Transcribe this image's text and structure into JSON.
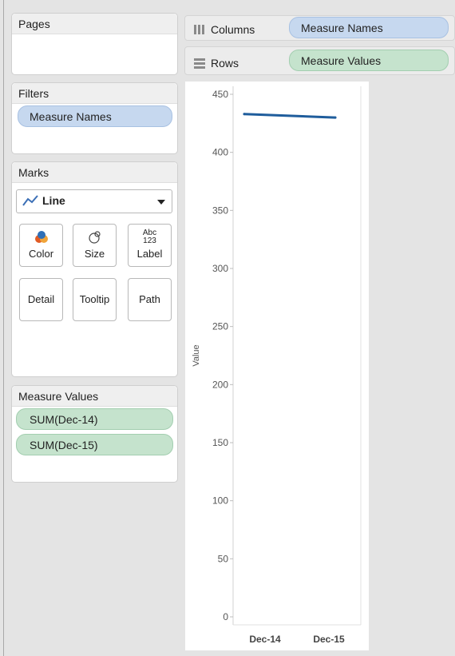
{
  "pages": {
    "title": "Pages"
  },
  "shelves": {
    "columns": {
      "label": "Columns",
      "pill": "Measure Names"
    },
    "rows": {
      "label": "Rows",
      "pill": "Measure Values"
    }
  },
  "filters": {
    "title": "Filters",
    "items": [
      "Measure Names"
    ]
  },
  "marks": {
    "title": "Marks",
    "mark_type": "Line",
    "buttons": {
      "color": "Color",
      "size": "Size",
      "label": "Label",
      "label_icon": "Abc 123",
      "detail": "Detail",
      "tooltip": "Tooltip",
      "path": "Path"
    }
  },
  "measure_values": {
    "title": "Measure Values",
    "items": [
      "SUM(Dec-14)",
      "SUM(Dec-15)"
    ]
  },
  "chart_data": {
    "type": "line",
    "categories": [
      "Dec-14",
      "Dec-15"
    ],
    "values": [
      433,
      430
    ],
    "ylabel": "Value",
    "ylim": [
      0,
      450
    ],
    "yticks": [
      0,
      50,
      100,
      150,
      200,
      250,
      300,
      350,
      400,
      450
    ],
    "line_color": "#1f5d9c",
    "grid": false
  },
  "colors": {
    "blue_pill": "#c6d8ef",
    "green_pill": "#c5e3cd",
    "line": "#1f5d9c"
  }
}
